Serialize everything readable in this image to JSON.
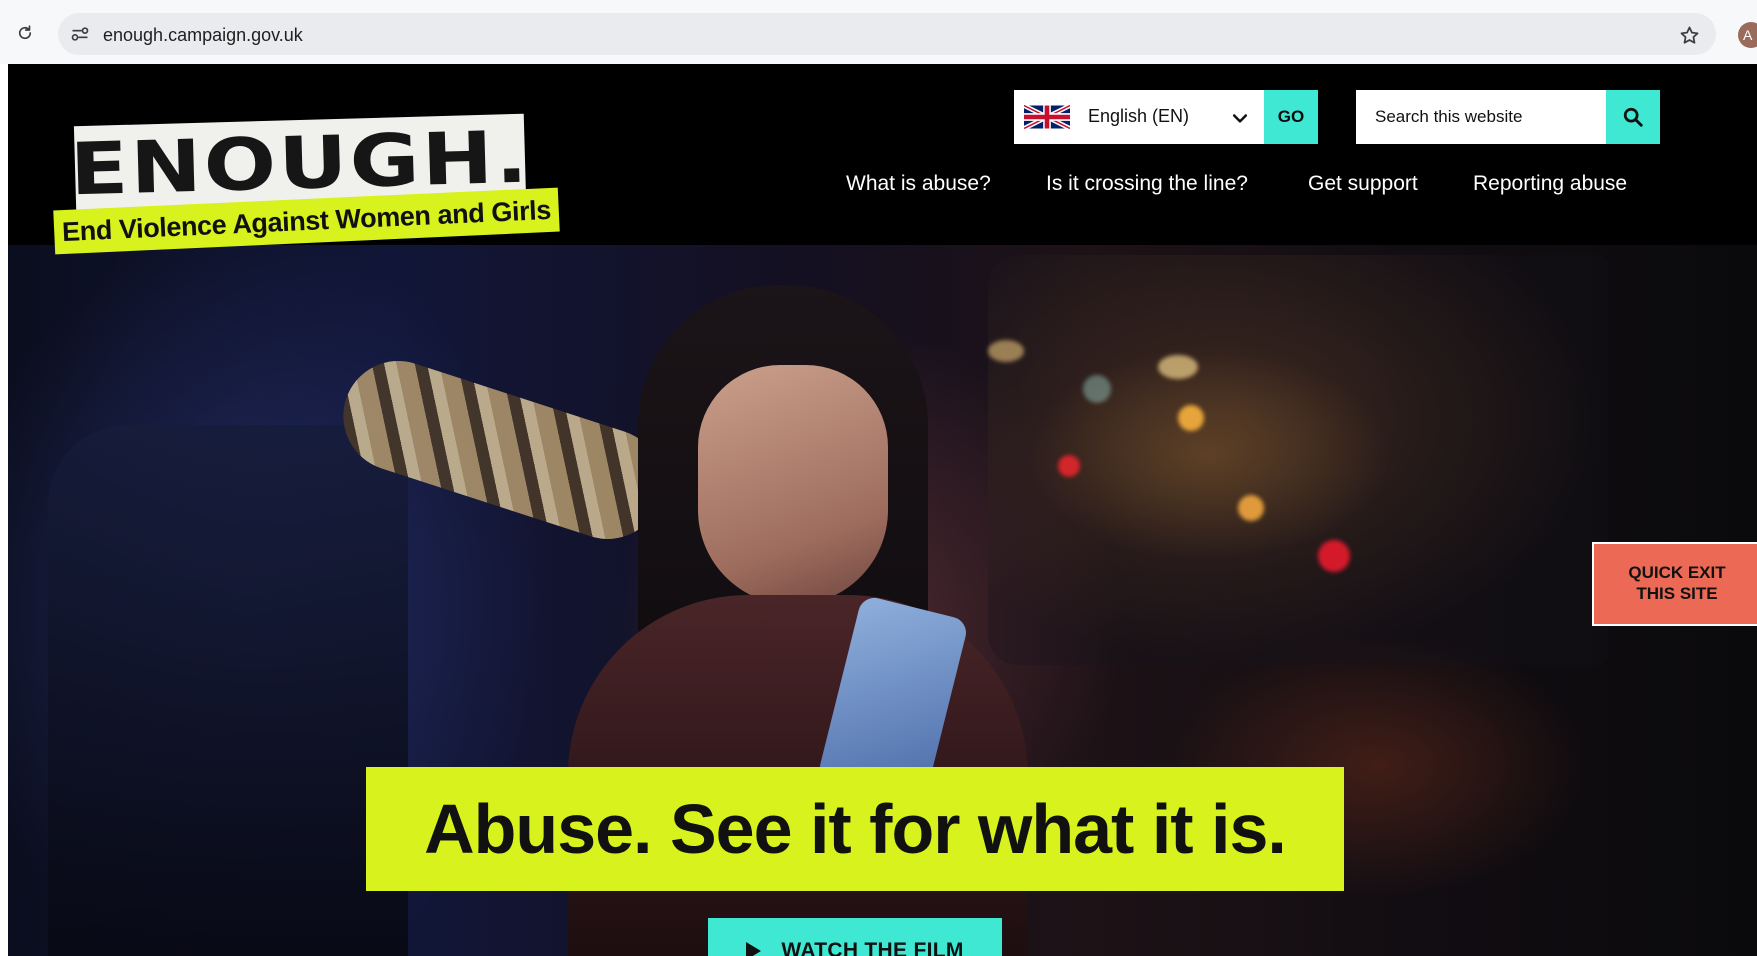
{
  "browser": {
    "url": "enough.campaign.gov.uk",
    "avatar_letter": "A",
    "icons": {
      "reload": "reload-icon",
      "site_info": "tune-icon",
      "bookmark": "star-icon"
    }
  },
  "header": {
    "logo": {
      "word": "ENOUGH.",
      "tagline": "End Violence Against Women and Girls"
    },
    "language": {
      "selected": "English (EN)",
      "go_label": "GO",
      "flag_icon": "uk-flag-icon"
    },
    "search": {
      "placeholder": "Search this website",
      "icon": "search-icon"
    },
    "nav": [
      {
        "label": "What is abuse?"
      },
      {
        "label": "Is it crossing the line?"
      },
      {
        "label": "Get support"
      },
      {
        "label": "Reporting abuse"
      }
    ]
  },
  "hero": {
    "headline": "Abuse. See it for what it is.",
    "cta_label": "WATCH THE FILM"
  },
  "quick_exit": {
    "line1": "QUICK EXIT",
    "line2": "THIS SITE"
  },
  "colors": {
    "accent_lime": "#d8f21d",
    "accent_teal": "#3ee8d3",
    "quick_exit": "#ec6a55",
    "header_bg": "#000000"
  }
}
